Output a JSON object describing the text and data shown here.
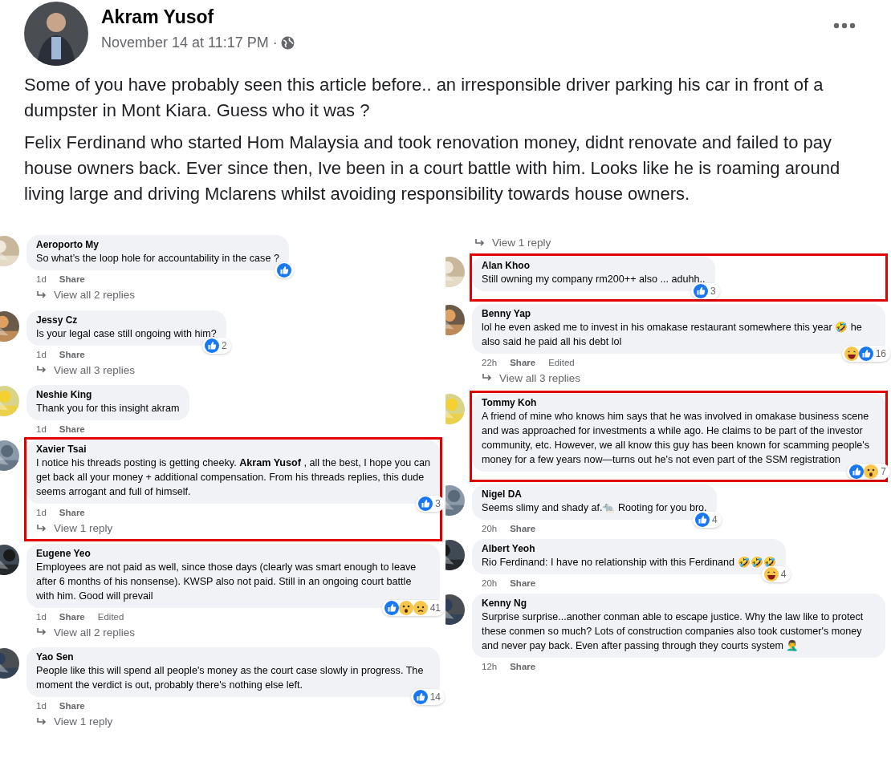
{
  "post": {
    "author": "Akram Yusof",
    "time": "November 14 at 11:17 PM ·",
    "paragraphs": [
      "Some of you have probably seen this article before.. an irresponsible driver parking his car in front of a dumpster in Mont Kiara. Guess who it was ?",
      "Felix Ferdinand who started Hom Malaysia and took renovation money, didnt renovate and failed to pay house owners back. Ever since then, Ive been in a court battle with him. Looks like he is roaming around living large and driving Mclarens whilst avoiding responsibility towards house owners."
    ]
  },
  "columns": [
    {
      "comments": [
        {
          "author": "Aeroporto My",
          "text": "So what’s the loop hole for accountability in the case ?",
          "reactions": [
            {
              "kind": "like"
            }
          ],
          "time": "1d",
          "links": [
            "Share"
          ],
          "replies": "View all 2 replies",
          "highlighted": false
        },
        {
          "author": "Jessy Cz",
          "text": "Is your legal case still ongoing with him?",
          "reactions": [
            {
              "kind": "like"
            }
          ],
          "count": "2",
          "time": "1d",
          "links": [
            "Share"
          ],
          "replies": "View all 3 replies",
          "highlighted": false
        },
        {
          "author": "Neshie King",
          "text": "Thank you for this insight akram",
          "time": "1d",
          "links": [
            "Share"
          ],
          "highlighted": false
        },
        {
          "author": "Xavier Tsai",
          "text": "I notice his threads posting is getting cheeky. **Akram Yusof** , all the best, I hope you can get back all your money + additional compensation. From his threads replies, this dude seems arrogant and full of himself.",
          "reactions": [
            {
              "kind": "like"
            }
          ],
          "count": "3",
          "time": "1d",
          "links": [
            "Share"
          ],
          "replies": "View 1 reply",
          "highlighted": true
        },
        {
          "author": "Eugene Yeo",
          "text": "Employees are not paid as well, since those days (clearly was smart enough to leave after 6 months of his nonsense). KWSP also not paid. Still in an ongoing court battle with him. Good will prevail",
          "reactions": [
            {
              "kind": "like"
            },
            {
              "kind": "wow"
            },
            {
              "kind": "sad"
            }
          ],
          "count": "41",
          "time": "1d",
          "links": [
            "Share"
          ],
          "edited": "Edited",
          "replies": "View all 2 replies",
          "highlighted": false
        },
        {
          "author": "Yao Sen",
          "text": "People like this will spend all people's money as the court case slowly in progress. The moment the verdict is out, probably there's nothing else left.",
          "reactions": [
            {
              "kind": "like"
            }
          ],
          "count": "14",
          "time": "1d",
          "links": [
            "Share"
          ],
          "replies": "View 1 reply",
          "highlighted": false
        }
      ]
    },
    {
      "leading_replies": "View 1 reply",
      "comments": [
        {
          "author": "Alan Khoo",
          "text": "Still owning my company rm200++ also ... aduhh..",
          "reactions": [
            {
              "kind": "like"
            }
          ],
          "count": "3",
          "highlighted": true
        },
        {
          "author": "Benny Yap",
          "text": "lol he even asked me to invest in his omakase restaurant somewhere this year 🤣 he also said he paid all his debt lol",
          "reactions": [
            {
              "kind": "haha"
            },
            {
              "kind": "like"
            }
          ],
          "count": "16",
          "time": "22h",
          "links": [
            "Share"
          ],
          "edited": "Edited",
          "replies": "View all 3 replies",
          "highlighted": false
        },
        {
          "author": "Tommy Koh",
          "text": "A friend of mine who knows him says that he was involved in omakase business scene and was approached for investments a while ago. He claims to be part of the investor community, etc. However, we all know this guy has been known for scamming people's money for a few years now—turns out he's not even part of the SSM registration",
          "reactions": [
            {
              "kind": "like"
            },
            {
              "kind": "wow"
            }
          ],
          "count": "7",
          "highlighted": true
        },
        {
          "author": "Nigel DA",
          "text": "Seems slimy and shady af.🐀 Rooting for you bro.",
          "reactions": [
            {
              "kind": "like"
            }
          ],
          "count": "4",
          "time": "20h",
          "links": [
            "Share"
          ],
          "highlighted": false
        },
        {
          "author": "Albert Yeoh",
          "text": "Rio Ferdinand: I have no relationship with this Ferdinand 🤣🤣🤣",
          "reactions": [
            {
              "kind": "haha"
            }
          ],
          "count": "4",
          "time": "20h",
          "links": [
            "Share"
          ],
          "highlighted": false
        },
        {
          "author": "Kenny Ng",
          "text": "Surprise surprise...another conman able to escape justice. Why the law like to protect these conmen so much? Lots of construction companies also took customer's money and never pay back. Even after passing through they courts system 🤦‍♂️",
          "time": "12h",
          "links": [
            "Share"
          ],
          "highlighted": false
        }
      ]
    }
  ]
}
